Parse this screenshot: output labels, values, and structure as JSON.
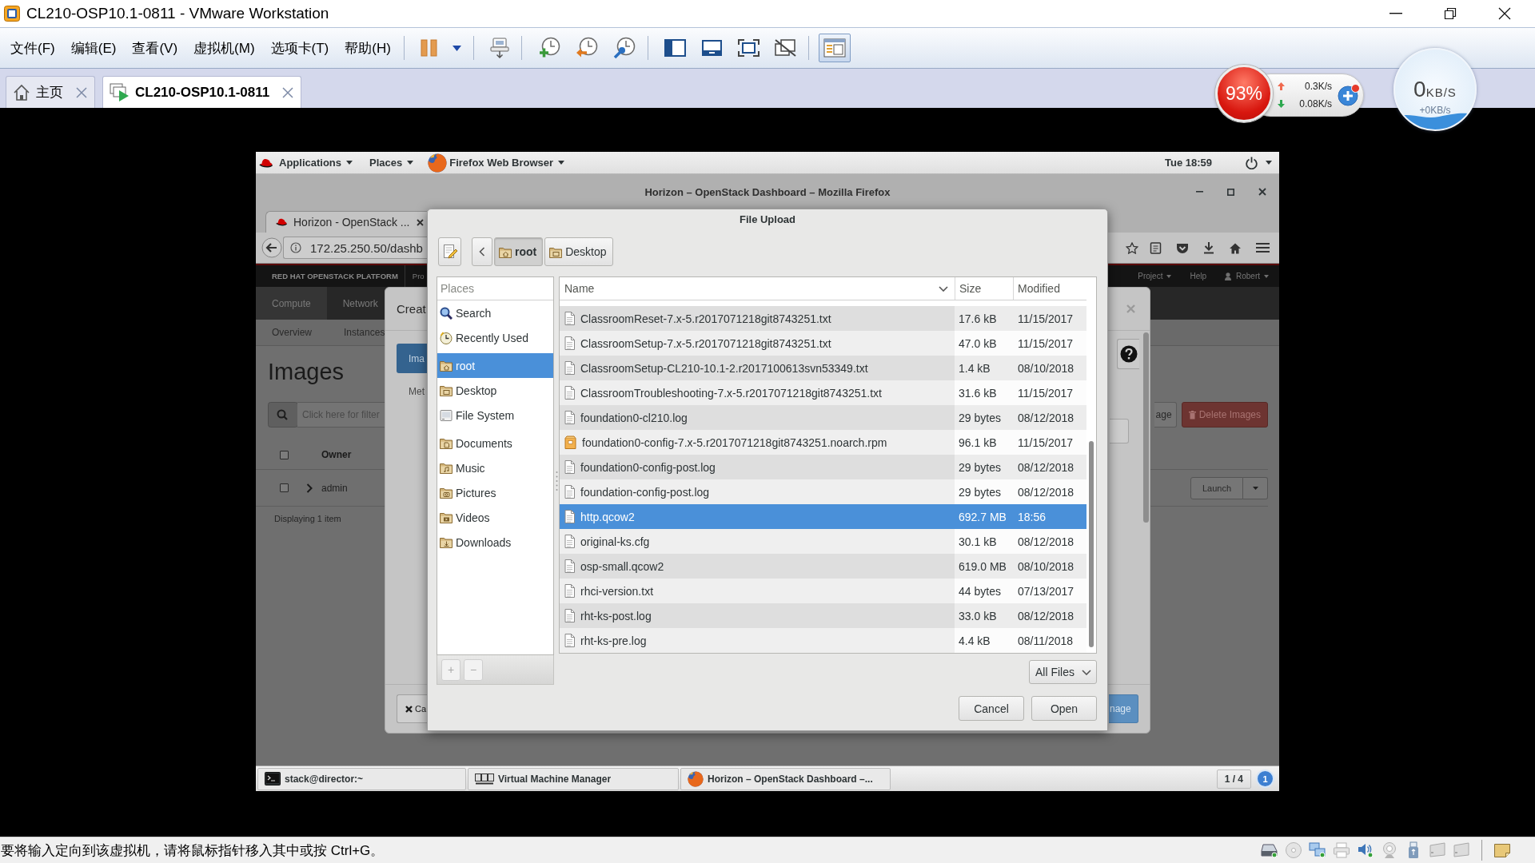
{
  "window": {
    "title": "CL210-OSP10.1-0811 - VMware Workstation"
  },
  "menu": [
    "文件(F)",
    "编辑(E)",
    "查看(V)",
    "虚拟机(M)",
    "选项卡(T)",
    "帮助(H)"
  ],
  "toolbar": [
    [
      {
        "kind": "pause",
        "pressed": false
      },
      {
        "kind": "dropdown",
        "pressed": false
      }
    ],
    [
      {
        "kind": "keys",
        "pressed": false
      }
    ],
    [
      {
        "kind": "snapshot",
        "pressed": false
      },
      {
        "kind": "revert",
        "pressed": false
      },
      {
        "kind": "manager",
        "pressed": false
      }
    ],
    [
      {
        "kind": "console",
        "pressed": false
      },
      {
        "kind": "single",
        "pressed": false
      },
      {
        "kind": "fullscreen",
        "pressed": false
      },
      {
        "kind": "unity",
        "pressed": false
      }
    ],
    [
      {
        "kind": "library",
        "pressed": true
      }
    ]
  ],
  "tabs": [
    {
      "label": "主页",
      "kind": "home",
      "selected": false
    },
    {
      "label": "CL210-OSP10.1-0811",
      "kind": "machine",
      "selected": true
    }
  ],
  "speed_monitor": {
    "usage": "93%",
    "upload": "0.3K/s",
    "download": "0.08K/s"
  },
  "speed_ball": {
    "value": "0",
    "unit": "KB/S",
    "change": "+0KB/s"
  },
  "guest": {
    "top_bar": {
      "menus": [
        "Applications",
        "Places"
      ],
      "app": "Firefox Web Browser",
      "clock": "Tue 18:59"
    },
    "browser": {
      "title": "Horizon – OpenStack Dashboard – Mozilla Firefox",
      "tab": "Horizon - OpenStack ...",
      "url": "172.25.250.50/dashb"
    },
    "dashboard": {
      "brand": "RED HAT OPENSTACK PLATFORM",
      "brand_next": "Pro",
      "header_links": [
        {
          "label": "Project",
          "kind": "menu"
        },
        {
          "label": "Help",
          "kind": "link"
        },
        {
          "label": "Robert",
          "kind": "user"
        }
      ],
      "nav": [
        {
          "label": "Compute",
          "selected": true
        },
        {
          "label": "Network",
          "selected": false
        }
      ],
      "subnav": [
        "Overview",
        "Instances"
      ],
      "heading": "Images",
      "filter": {
        "placeholder": "Click here for filter"
      },
      "actions": [
        {
          "label": "age",
          "kind": "default"
        },
        {
          "label": "Delete Images",
          "kind": "danger"
        }
      ],
      "table": {
        "header_checked": false,
        "columns": [
          "Owner"
        ],
        "rows": [
          {
            "owner": "admin",
            "checked": false,
            "expanded": false,
            "action": "Launch"
          }
        ],
        "summary": "Displaying 1 item"
      }
    },
    "modal": {
      "title": "Creat",
      "tabs": [
        {
          "label": "Ima",
          "selected": true
        },
        {
          "label": "Met",
          "selected": false
        }
      ],
      "cancel": "Ca",
      "submit": "nage"
    },
    "file_dialog": {
      "title": "File Upload",
      "path": [
        {
          "label": "root",
          "kind": "home",
          "selected": true
        },
        {
          "label": "Desktop",
          "kind": "desktop",
          "selected": false
        }
      ],
      "places_heading": "Places",
      "place_groups": [
        [
          {
            "label": "Search",
            "kind": "search",
            "selected": false
          },
          {
            "label": "Recently Used",
            "kind": "recent",
            "selected": false
          }
        ],
        [
          {
            "label": "root",
            "kind": "home",
            "selected": true
          },
          {
            "label": "Desktop",
            "kind": "desktop",
            "selected": false
          },
          {
            "label": "File System",
            "kind": "drive",
            "selected": false
          }
        ],
        [
          {
            "label": "Documents",
            "kind": "documents",
            "selected": false
          },
          {
            "label": "Music",
            "kind": "music",
            "selected": false
          },
          {
            "label": "Pictures",
            "kind": "pictures",
            "selected": false
          },
          {
            "label": "Videos",
            "kind": "videos",
            "selected": false
          },
          {
            "label": "Downloads",
            "kind": "downloads",
            "selected": false
          }
        ]
      ],
      "place_buttons": [
        {
          "label": "+",
          "disabled": true
        },
        {
          "label": "−",
          "disabled": true
        }
      ],
      "columns": [
        "Name",
        "Size",
        "Modified"
      ],
      "files": [
        {
          "name": "ClassroomReset-7.x-5.r2017071218git8743251.txt",
          "size": "17.6 kB",
          "modified": "11/15/2017",
          "kind": "text",
          "selected": false
        },
        {
          "name": "ClassroomSetup-7.x-5.r2017071218git8743251.txt",
          "size": "47.0 kB",
          "modified": "11/15/2017",
          "kind": "text",
          "selected": false
        },
        {
          "name": "ClassroomSetup-CL210-10.1-2.r2017100613svn53349.txt",
          "size": "1.4 kB",
          "modified": "08/10/2018",
          "kind": "text",
          "selected": false
        },
        {
          "name": "ClassroomTroubleshooting-7.x-5.r2017071218git8743251.txt",
          "size": "31.6 kB",
          "modified": "11/15/2017",
          "kind": "text",
          "selected": false
        },
        {
          "name": "foundation0-cl210.log",
          "size": "29 bytes",
          "modified": "08/12/2018",
          "kind": "text",
          "selected": false
        },
        {
          "name": "foundation0-config-7.x-5.r2017071218git8743251.noarch.rpm",
          "size": "96.1 kB",
          "modified": "11/15/2017",
          "kind": "package",
          "selected": false
        },
        {
          "name": "foundation0-config-post.log",
          "size": "29 bytes",
          "modified": "08/12/2018",
          "kind": "text",
          "selected": false
        },
        {
          "name": "foundation-config-post.log",
          "size": "29 bytes",
          "modified": "08/12/2018",
          "kind": "text",
          "selected": false
        },
        {
          "name": "http.qcow2",
          "size": "692.7 MB",
          "modified": "18:56",
          "kind": "text",
          "selected": true
        },
        {
          "name": "original-ks.cfg",
          "size": "30.1 kB",
          "modified": "08/12/2018",
          "kind": "text",
          "selected": false
        },
        {
          "name": "osp-small.qcow2",
          "size": "619.0 MB",
          "modified": "08/10/2018",
          "kind": "text",
          "selected": false
        },
        {
          "name": "rhci-version.txt",
          "size": "44 bytes",
          "modified": "07/13/2017",
          "kind": "text",
          "selected": false
        },
        {
          "name": "rht-ks-post.log",
          "size": "33.0 kB",
          "modified": "08/12/2018",
          "kind": "text",
          "selected": false
        },
        {
          "name": "rht-ks-pre.log",
          "size": "4.4 kB",
          "modified": "08/11/2018",
          "kind": "text",
          "selected": false
        }
      ],
      "filter": "All Files",
      "buttons": [
        "Cancel",
        "Open"
      ]
    },
    "taskbar": {
      "windows": [
        {
          "label": "stack@director:~",
          "kind": "terminal"
        },
        {
          "label": "Virtual Machine Manager",
          "kind": "manager"
        },
        {
          "label": "Horizon – OpenStack Dashboard –...",
          "kind": "browser"
        }
      ],
      "workspace": "1 / 4",
      "notifications": "1"
    }
  },
  "status_bar": {
    "message": "要将输入定向到该虚拟机，请将鼠标指针移入其中或按 Ctrl+G。",
    "devices": [
      {
        "kind": "disk",
        "disabled": false
      },
      {
        "kind": "disc",
        "disabled": true
      },
      {
        "kind": "network",
        "disabled": false
      },
      {
        "kind": "printer",
        "disabled": true
      },
      {
        "kind": "sound",
        "disabled": false
      },
      {
        "kind": "camera",
        "disabled": true
      },
      {
        "kind": "usb",
        "disabled": false
      },
      {
        "kind": "display",
        "disabled": true
      },
      {
        "kind": "display",
        "disabled": true
      },
      {
        "kind": "message",
        "disabled": false
      }
    ]
  }
}
